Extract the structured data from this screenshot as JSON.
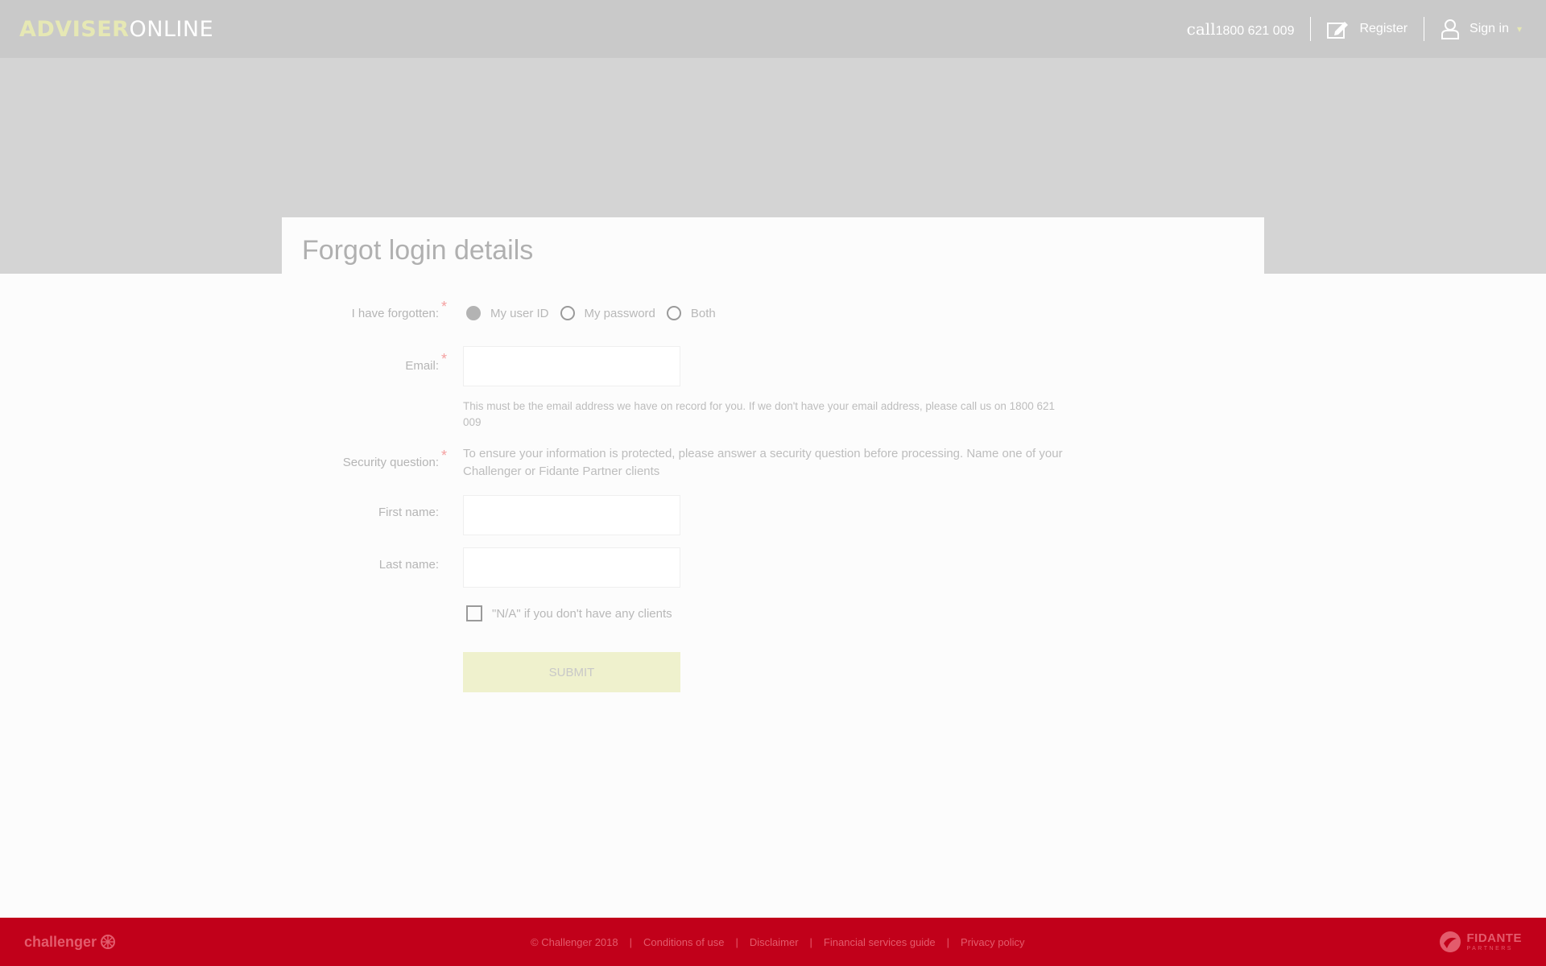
{
  "header": {
    "logo_part1": "ADVISER",
    "logo_part2": "ONLINE",
    "call_word": "call",
    "call_number": "1800 621 009",
    "register_label": "Register",
    "signin_label": "Sign in",
    "icons": {
      "register": "edit-icon",
      "signin": "user-icon",
      "dropdown": "chevron-down-icon"
    }
  },
  "page": {
    "title": "Forgot login details"
  },
  "form": {
    "forgotten_label": "I have forgotten:",
    "options": [
      "My user ID",
      "My password",
      "Both"
    ],
    "selected_option": "My user ID",
    "email_label": "Email:",
    "email_value": "",
    "email_help": "This must be the email address we have on record for you. If we don't have your email address, please call us on 1800 621 009",
    "security_label": "Security question:",
    "security_help": "To ensure your information is protected, please answer a security question before processing. Name one of your Challenger or Fidante Partner clients",
    "firstname_label": "First name:",
    "firstname_value": "",
    "lastname_label": "Last name:",
    "lastname_value": "",
    "na_checkbox_label": "\"N/A\" if you don't have any clients",
    "na_checked": false,
    "submit_label": "SUBMIT",
    "required_marker": "*"
  },
  "footer": {
    "brand_left": "challenger",
    "copyright": "© Challenger 2018",
    "links": [
      "Conditions of use",
      "Disclaimer",
      "Financial services guide",
      "Privacy policy"
    ],
    "separator": "|",
    "brand_right_top": "FIDANTE",
    "brand_right_bottom": "PARTNERS"
  },
  "colors": {
    "header_bg": "#c9c9c9",
    "hero_bg": "#d4d4d4",
    "accent": "#e6e8b4",
    "footer_bg": "#c1001a",
    "required": "#f4a0a0"
  }
}
